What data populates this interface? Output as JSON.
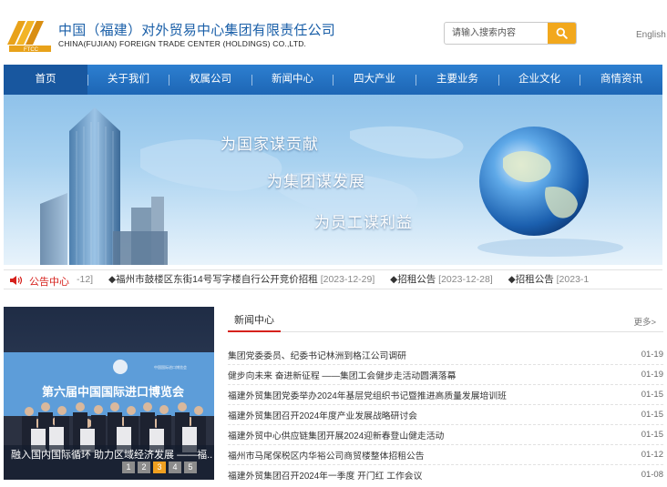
{
  "header": {
    "company_cn": "中国（福建）对外贸易中心集团有限责任公司",
    "company_en": "CHINA(FUJIAN) FOREIGN TRADE CENTER (HOLDINGS) CO.,LTD.",
    "search_placeholder": "请输入搜索内容",
    "english_link": "English"
  },
  "nav": {
    "items": [
      "首页",
      "关于我们",
      "权属公司",
      "新闻中心",
      "四大产业",
      "主要业务",
      "企业文化",
      "商情资讯"
    ],
    "active_index": 0
  },
  "banner": {
    "slogans": [
      "为国家谋贡献",
      "为集团谋发展",
      "为员工谋利益"
    ]
  },
  "notice": {
    "label": "公告中心",
    "lead_fragment": "-12]",
    "items": [
      {
        "title": "福州市鼓楼区东街14号写字楼自行公开竞价招租",
        "date": "[2023-12-29]"
      },
      {
        "title": "招租公告",
        "date": "[2023-12-28]"
      },
      {
        "title": "招租公告",
        "date": "[2023-1"
      }
    ]
  },
  "slideshow": {
    "caption": "融入国内国际循环 助力区域经济发展 ——福...",
    "pages": [
      "1",
      "2",
      "3",
      "4",
      "5"
    ],
    "active_page": 3,
    "photo_sign_main": "第六届中国国际进口博览会",
    "photo_sign_small": "中国国际进口博览会"
  },
  "news": {
    "tab": "新闻中心",
    "more": "更多>",
    "rows": [
      {
        "title": "集团党委委员、纪委书记林洲到格江公司调研",
        "date": "01-19"
      },
      {
        "title": "健步向未来 奋进新征程 ——集团工会健步走活动圆满落幕",
        "date": "01-19"
      },
      {
        "title": "福建外贸集团党委举办2024年基层党组织书记暨推进高质量发展培训班",
        "date": "01-15"
      },
      {
        "title": "福建外贸集团召开2024年度产业发展战略研讨会",
        "date": "01-15"
      },
      {
        "title": "福建外贸中心供应链集团开展2024迎新春登山健走活动",
        "date": "01-15"
      },
      {
        "title": "福州市马尾保税区内华裕公司商贸楼整体招租公告",
        "date": "01-12"
      },
      {
        "title": "福建外贸集团召开2024年一季度 开门红 工作会议",
        "date": "01-08"
      }
    ]
  },
  "colors": {
    "brand_blue": "#1a5fa8",
    "nav_blue": "#2271c3",
    "accent_orange": "#f2a81d",
    "notice_red": "#d6211c"
  }
}
